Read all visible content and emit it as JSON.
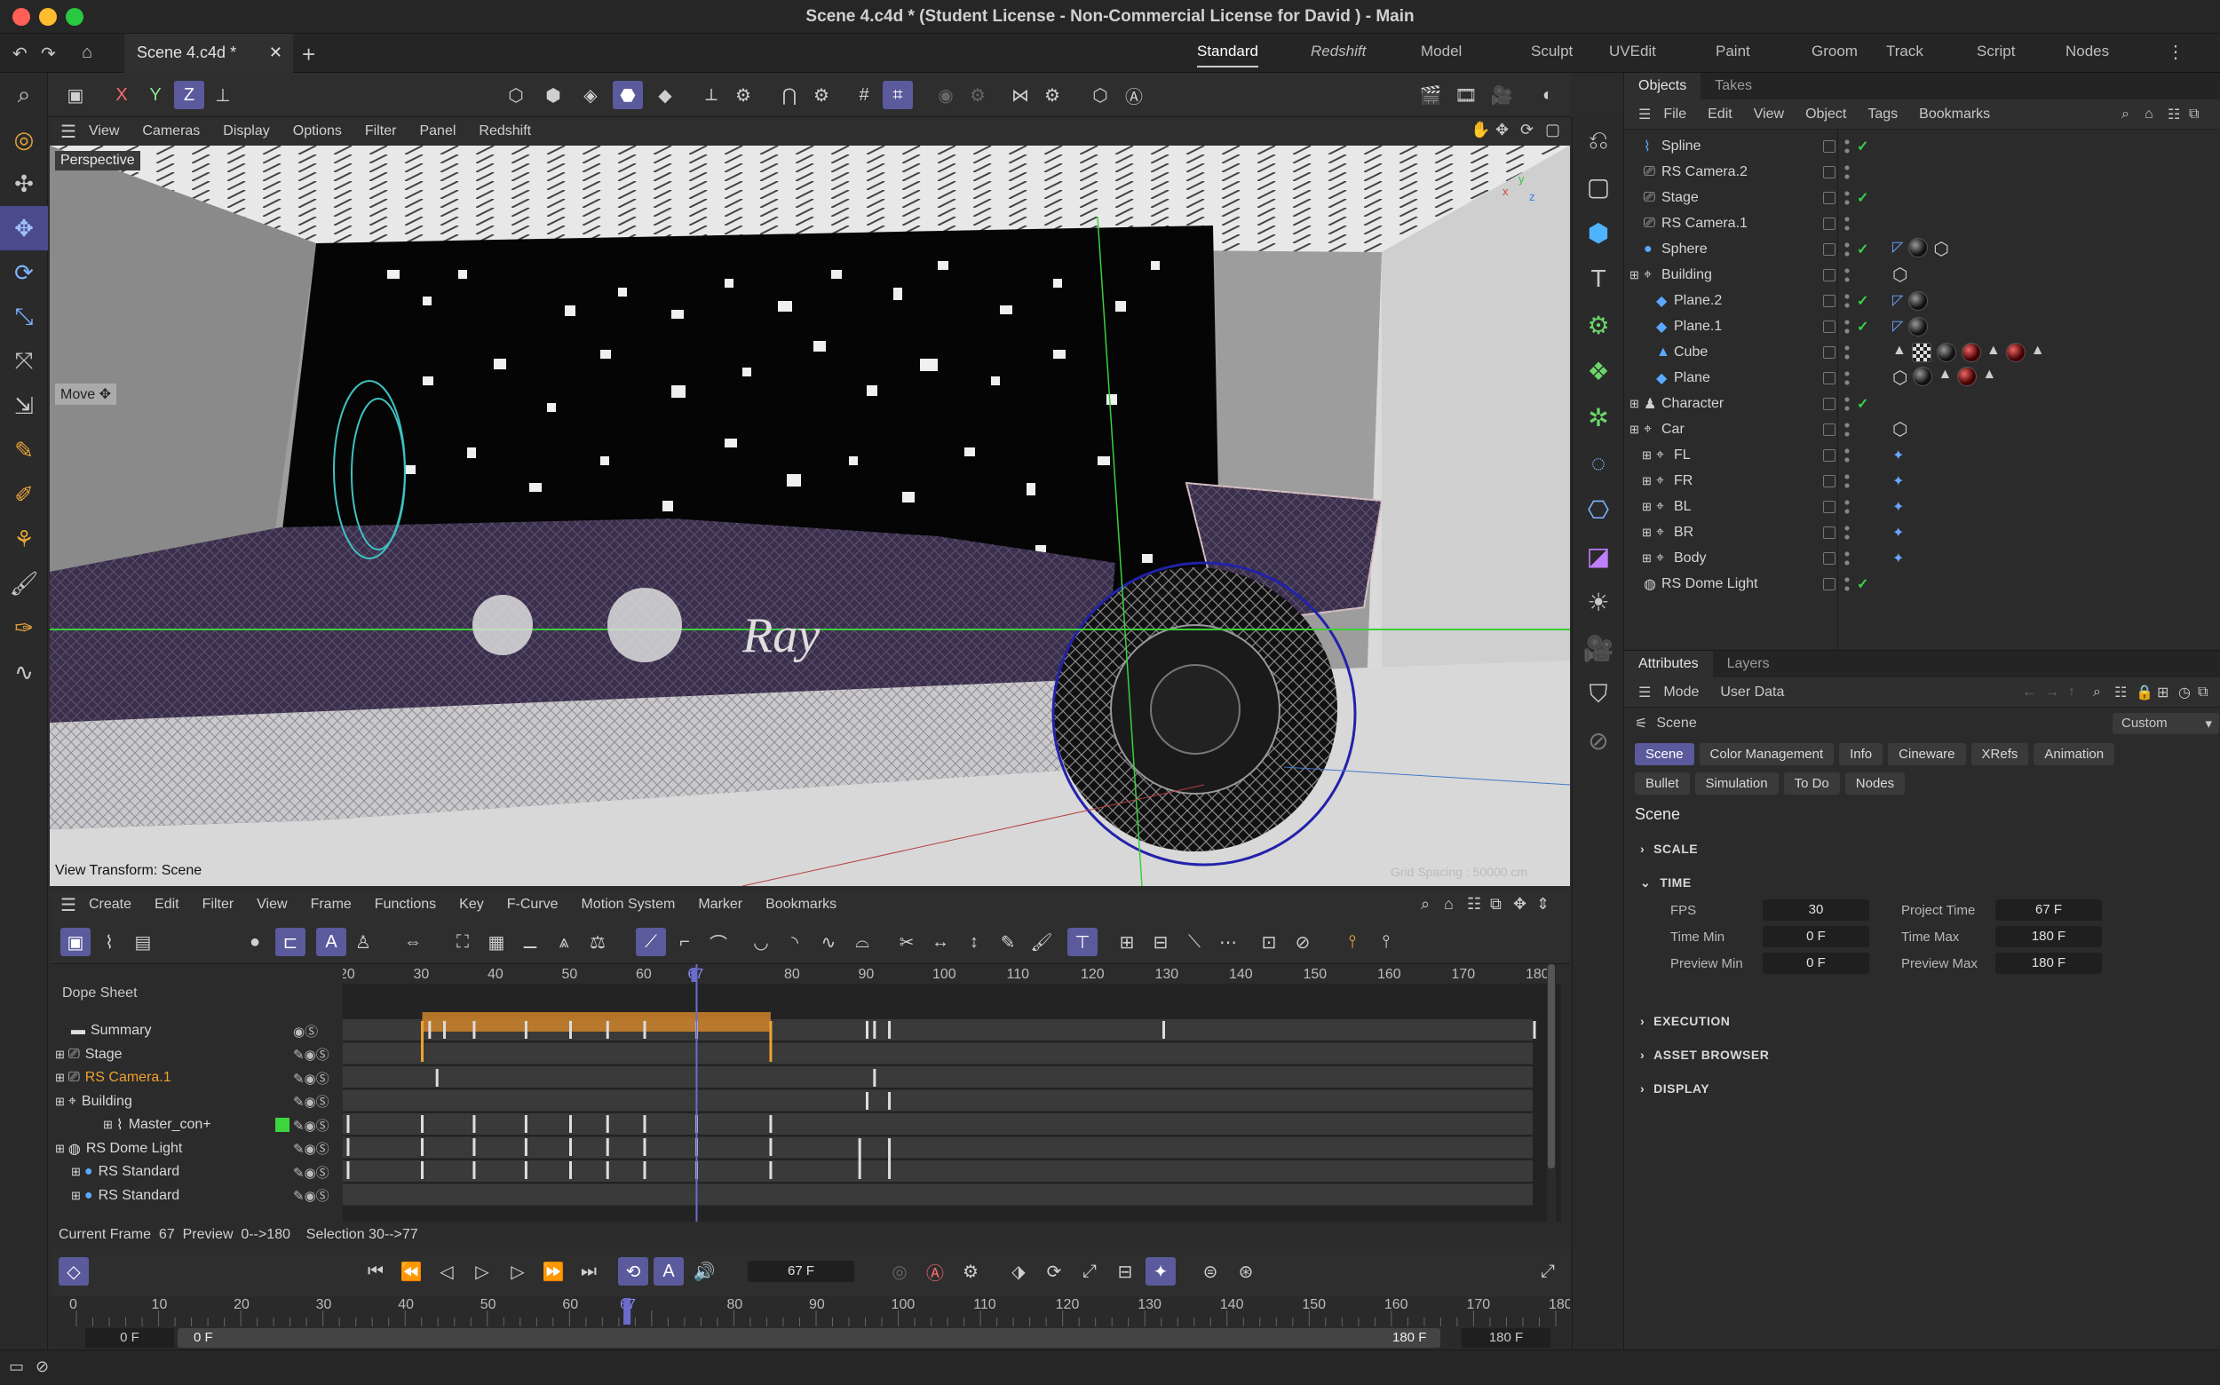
{
  "window": {
    "title": "Scene 4.c4d * (Student License - Non-Commercial License for David ) - Main"
  },
  "tabs": {
    "file_tab": "Scene 4.c4d *",
    "layouts": [
      "Standard",
      "Redshift",
      "Model",
      "Sculpt",
      "UVEdit",
      "Paint",
      "Groom",
      "Track",
      "Script",
      "Nodes"
    ],
    "active_layout": "Standard"
  },
  "viewport": {
    "menu": [
      "View",
      "Cameras",
      "Display",
      "Options",
      "Filter",
      "Panel",
      "Redshift"
    ],
    "camera_label": "Perspective",
    "tool_label": "Move",
    "transform_label": "View Transform: Scene",
    "grid_spacing": "Grid Spacing : 50000 cm",
    "axis_labels": [
      "x",
      "y",
      "z"
    ]
  },
  "objects": {
    "tabs": [
      "Objects",
      "Takes"
    ],
    "menu": [
      "File",
      "Edit",
      "View",
      "Object",
      "Tags",
      "Bookmarks"
    ],
    "rows": [
      {
        "name": "Spline",
        "icon": "spline-icon",
        "check": "✓"
      },
      {
        "name": "RS Camera.2",
        "icon": "camera-icon",
        "check": ""
      },
      {
        "name": "Stage",
        "icon": "stage-icon",
        "check": "✓"
      },
      {
        "name": "RS Camera.1",
        "icon": "camera-icon",
        "check": ""
      },
      {
        "name": "Sphere",
        "icon": "sphere-icon",
        "check": "✓"
      },
      {
        "name": "Building",
        "icon": "null-icon",
        "check": ""
      },
      {
        "name": "Plane.2",
        "icon": "plane-icon",
        "check": "✓"
      },
      {
        "name": "Plane.1",
        "icon": "plane-icon",
        "check": "✓"
      },
      {
        "name": "Cube",
        "icon": "cube-icon",
        "check": ""
      },
      {
        "name": "Plane",
        "icon": "plane-icon",
        "check": ""
      },
      {
        "name": "Character",
        "icon": "character-icon",
        "check": "✓"
      },
      {
        "name": "Car",
        "icon": "null-icon",
        "check": ""
      },
      {
        "name": "FL",
        "icon": "null-icon",
        "check": ""
      },
      {
        "name": "FR",
        "icon": "null-icon",
        "check": ""
      },
      {
        "name": "BL",
        "icon": "null-icon",
        "check": ""
      },
      {
        "name": "BR",
        "icon": "null-icon",
        "check": ""
      },
      {
        "name": "Body",
        "icon": "null-icon",
        "check": ""
      },
      {
        "name": "RS Dome Light",
        "icon": "dome-light-icon",
        "check": "✓"
      }
    ]
  },
  "attributes": {
    "tabs": [
      "Attributes",
      "Layers"
    ],
    "menu": [
      "Mode",
      "User Data"
    ],
    "object": "Scene",
    "preset": "Custom",
    "chips": [
      "Scene",
      "Color Management",
      "Info",
      "Cineware",
      "XRefs",
      "Animation",
      "Bullet",
      "Simulation",
      "To Do",
      "Nodes"
    ],
    "heading": "Scene",
    "sections": [
      "SCALE",
      "TIME",
      "EXECUTION",
      "ASSET BROWSER",
      "DISPLAY"
    ],
    "time": {
      "fps_label": "FPS",
      "fps": "30",
      "project_time_label": "Project Time",
      "project_time": "67 F",
      "time_min_label": "Time Min",
      "time_min": "0 F",
      "time_max_label": "Time Max",
      "time_max": "180 F",
      "preview_min_label": "Preview Min",
      "preview_min": "0 F",
      "preview_max_label": "Preview Max",
      "preview_max": "180 F"
    }
  },
  "timeline": {
    "menu": [
      "Create",
      "Edit",
      "Filter",
      "View",
      "Frame",
      "Functions",
      "Key",
      "F-Curve",
      "Motion System",
      "Marker",
      "Bookmarks"
    ],
    "title": "Dope Sheet",
    "ticks": [
      "20",
      "30",
      "40",
      "50",
      "60",
      "67",
      "80",
      "90",
      "100",
      "110",
      "120",
      "130",
      "140",
      "150",
      "160",
      "170",
      "180"
    ],
    "tracks": [
      "Summary",
      "Stage",
      "RS Camera.1",
      "Building",
      "Master_con+",
      "RS Dome Light",
      "RS Standard",
      "RS Standard"
    ],
    "status": "Current Frame  67  Preview  0-->180    Selection 30-->77",
    "frame_field": "67 F",
    "ruler": [
      "0",
      "10",
      "20",
      "30",
      "40",
      "50",
      "60",
      "67",
      "80",
      "90",
      "100",
      "110",
      "120",
      "130",
      "140",
      "150",
      "160",
      "170",
      "180"
    ],
    "range_start": "0 F",
    "range_start2": "0 F",
    "range_end": "180 F",
    "range_end2": "180 F",
    "current_frame": 67,
    "max_frame": 180
  }
}
